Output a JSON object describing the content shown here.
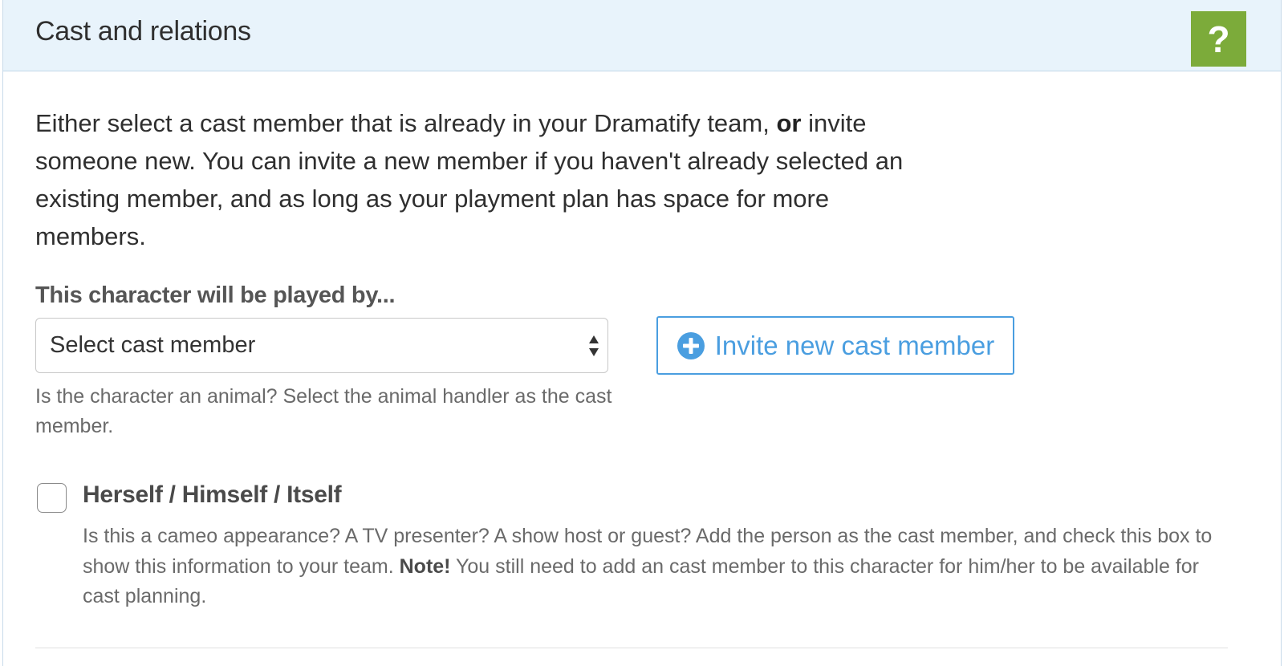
{
  "header": {
    "title": "Cast and relations",
    "help_label": "?",
    "help_color": "#7cab3a"
  },
  "intro": {
    "part1": "Either select a cast member that is already in your Dramatify team,",
    "emphasis": "or",
    "part2": "invite someone new. You can invite a new member if you haven't already selected an existing member, and as long as your playment plan has space for more members."
  },
  "cast_field": {
    "label": "This character will be played by...",
    "select_value": "Select cast member",
    "hint": "Is the character an animal? Select the animal handler as the cast member."
  },
  "invite": {
    "label": "Invite new cast member",
    "icon": "plus-circle-icon",
    "accent": "#4a9ee0"
  },
  "self_option": {
    "label": "Herself / Himself / Itself",
    "checked": false,
    "help_part1": "Is this a cameo appearance? A TV presenter? A show host or guest? Add the person as the cast member, and check this box to show this information to your team.",
    "note": "Note!",
    "help_part2": "You still need to add an cast member to this character for him/her to be available for cast planning."
  }
}
